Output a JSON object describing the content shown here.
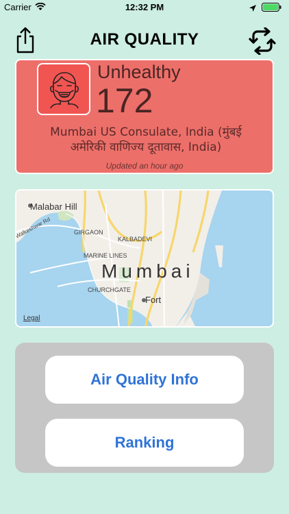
{
  "status_bar": {
    "carrier": "Carrier",
    "time": "12:32 PM"
  },
  "header": {
    "title": "AIR QUALITY"
  },
  "air_quality": {
    "level": "Unhealthy",
    "aqi": "172",
    "station_line1": "Mumbai US Consulate, India (मुंबई",
    "station_line2": "अमेरिकी वाणिज्य दूतावास, India)",
    "updated": "Updated an hour ago",
    "card_color": "#ed6f6a"
  },
  "map": {
    "city": "Mumbai",
    "labels": {
      "malabar_hill": "Malabar Hill",
      "walkeshwar": "Walkeshwar Rd",
      "girgaon": "GIRGAON",
      "kalbadevi": "KALBADEVI",
      "marine_lines": "MARINE LINES",
      "churchgate": "CHURCHGATE",
      "fort": "Fort"
    },
    "legal": "Legal"
  },
  "buttons": {
    "info": "Air Quality Info",
    "ranking": "Ranking"
  }
}
